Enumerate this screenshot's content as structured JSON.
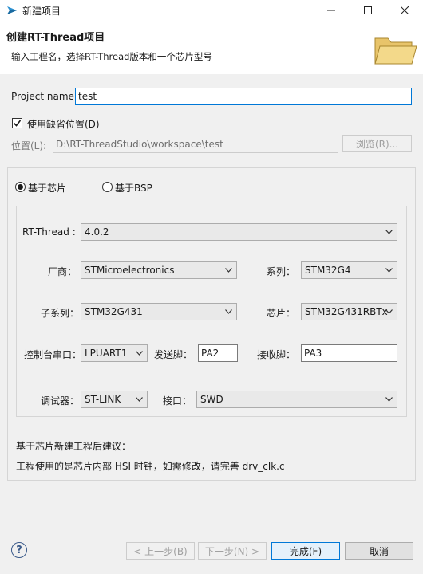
{
  "window": {
    "title": "新建项目",
    "icon": "rt-thread-logo-icon"
  },
  "header": {
    "title": "创建RT-Thread项目",
    "description": "输入工程名，选择RT-Thread版本和一个芯片型号"
  },
  "project": {
    "name_label": "Project name:",
    "name_value": "test",
    "use_default_label": "使用缺省位置(D)",
    "use_default_checked": true,
    "location_label": "位置(L):",
    "location_value": "D:\\RT-ThreadStudio\\workspace\\test",
    "browse_label": "浏览(R)..."
  },
  "mode": {
    "chip_label": "基于芯片",
    "bsp_label": "基于BSP",
    "selected": "chip"
  },
  "chip_config": {
    "rtthread_label": "RT-Thread :",
    "rtthread_value": "4.0.2",
    "vendor_label": "厂商：",
    "vendor_value": "STMicroelectronics",
    "series_label": "系列：",
    "series_value": "STM32G4",
    "subseries_label": "子系列：",
    "subseries_value": "STM32G431",
    "chip_label": "芯片：",
    "chip_value": "STM32G431RBTx",
    "console_label": "控制台串口：",
    "console_value": "LPUART1",
    "tx_label": "发送脚：",
    "tx_value": "PA2",
    "rx_label": "接收脚：",
    "rx_value": "PA3",
    "debugger_label": "调试器：",
    "debugger_value": "ST-LINK",
    "interface_label": "接口：",
    "interface_value": "SWD"
  },
  "advice": {
    "title": "基于芯片新建工程后建议：",
    "text": "工程使用的是芯片内部 HSI 时钟，如需修改，请完善 drv_clk.c"
  },
  "buttons": {
    "back": "< 上一步(B)",
    "next": "下一步(N) >",
    "finish": "完成(F)",
    "cancel": "取消"
  },
  "colors": {
    "accent": "#0078d7",
    "dialog_bg": "#f0f0f0",
    "logo": "#2a8fd0"
  }
}
